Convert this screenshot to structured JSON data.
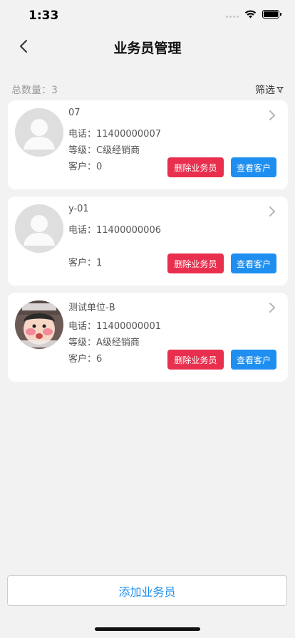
{
  "status": {
    "time": "1:33"
  },
  "nav": {
    "title": "业务员管理"
  },
  "toolbar": {
    "total_label": "总数量：3",
    "filter_label": "筛选"
  },
  "salespeople": [
    {
      "name": "07",
      "phone": "电话：11400000007",
      "level": "等级：C级经销商",
      "customers": "客户：0",
      "avatar": "default-person-icon"
    },
    {
      "name": "y-01",
      "phone": "电话：11400000006",
      "level": "",
      "customers": "客户：1",
      "avatar": "default-person-icon"
    },
    {
      "name": "测试单位-B",
      "phone": "电话：11400000001",
      "level": "等级：A级经销商",
      "customers": "客户：6",
      "avatar": "cartoon-photo"
    }
  ],
  "card_actions": {
    "delete_label": "删除业务员",
    "view_label": "查看客户"
  },
  "footer": {
    "add_label": "添加业务员"
  },
  "colors": {
    "delete": "#e8304e",
    "view": "#1e8ff0",
    "background": "#f2f2f2"
  }
}
